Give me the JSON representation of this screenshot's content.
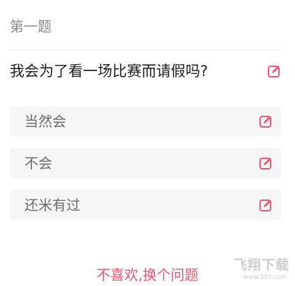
{
  "question": {
    "number_label": "第一题",
    "text": "我会为了看一场比赛而请假吗?"
  },
  "options": [
    {
      "label": "当然会"
    },
    {
      "label": "不会"
    },
    {
      "label": "还米有过"
    }
  ],
  "actions": {
    "change_question_label": "不喜欢,换个问题"
  },
  "watermark": {
    "title": "飞翔下载",
    "url": "www.52z.com"
  },
  "icons": {
    "edit": "edit-icon"
  },
  "colors": {
    "accent": "#f05470",
    "option_bg": "#f6f6f6",
    "muted_text": "#8a8a8a"
  }
}
